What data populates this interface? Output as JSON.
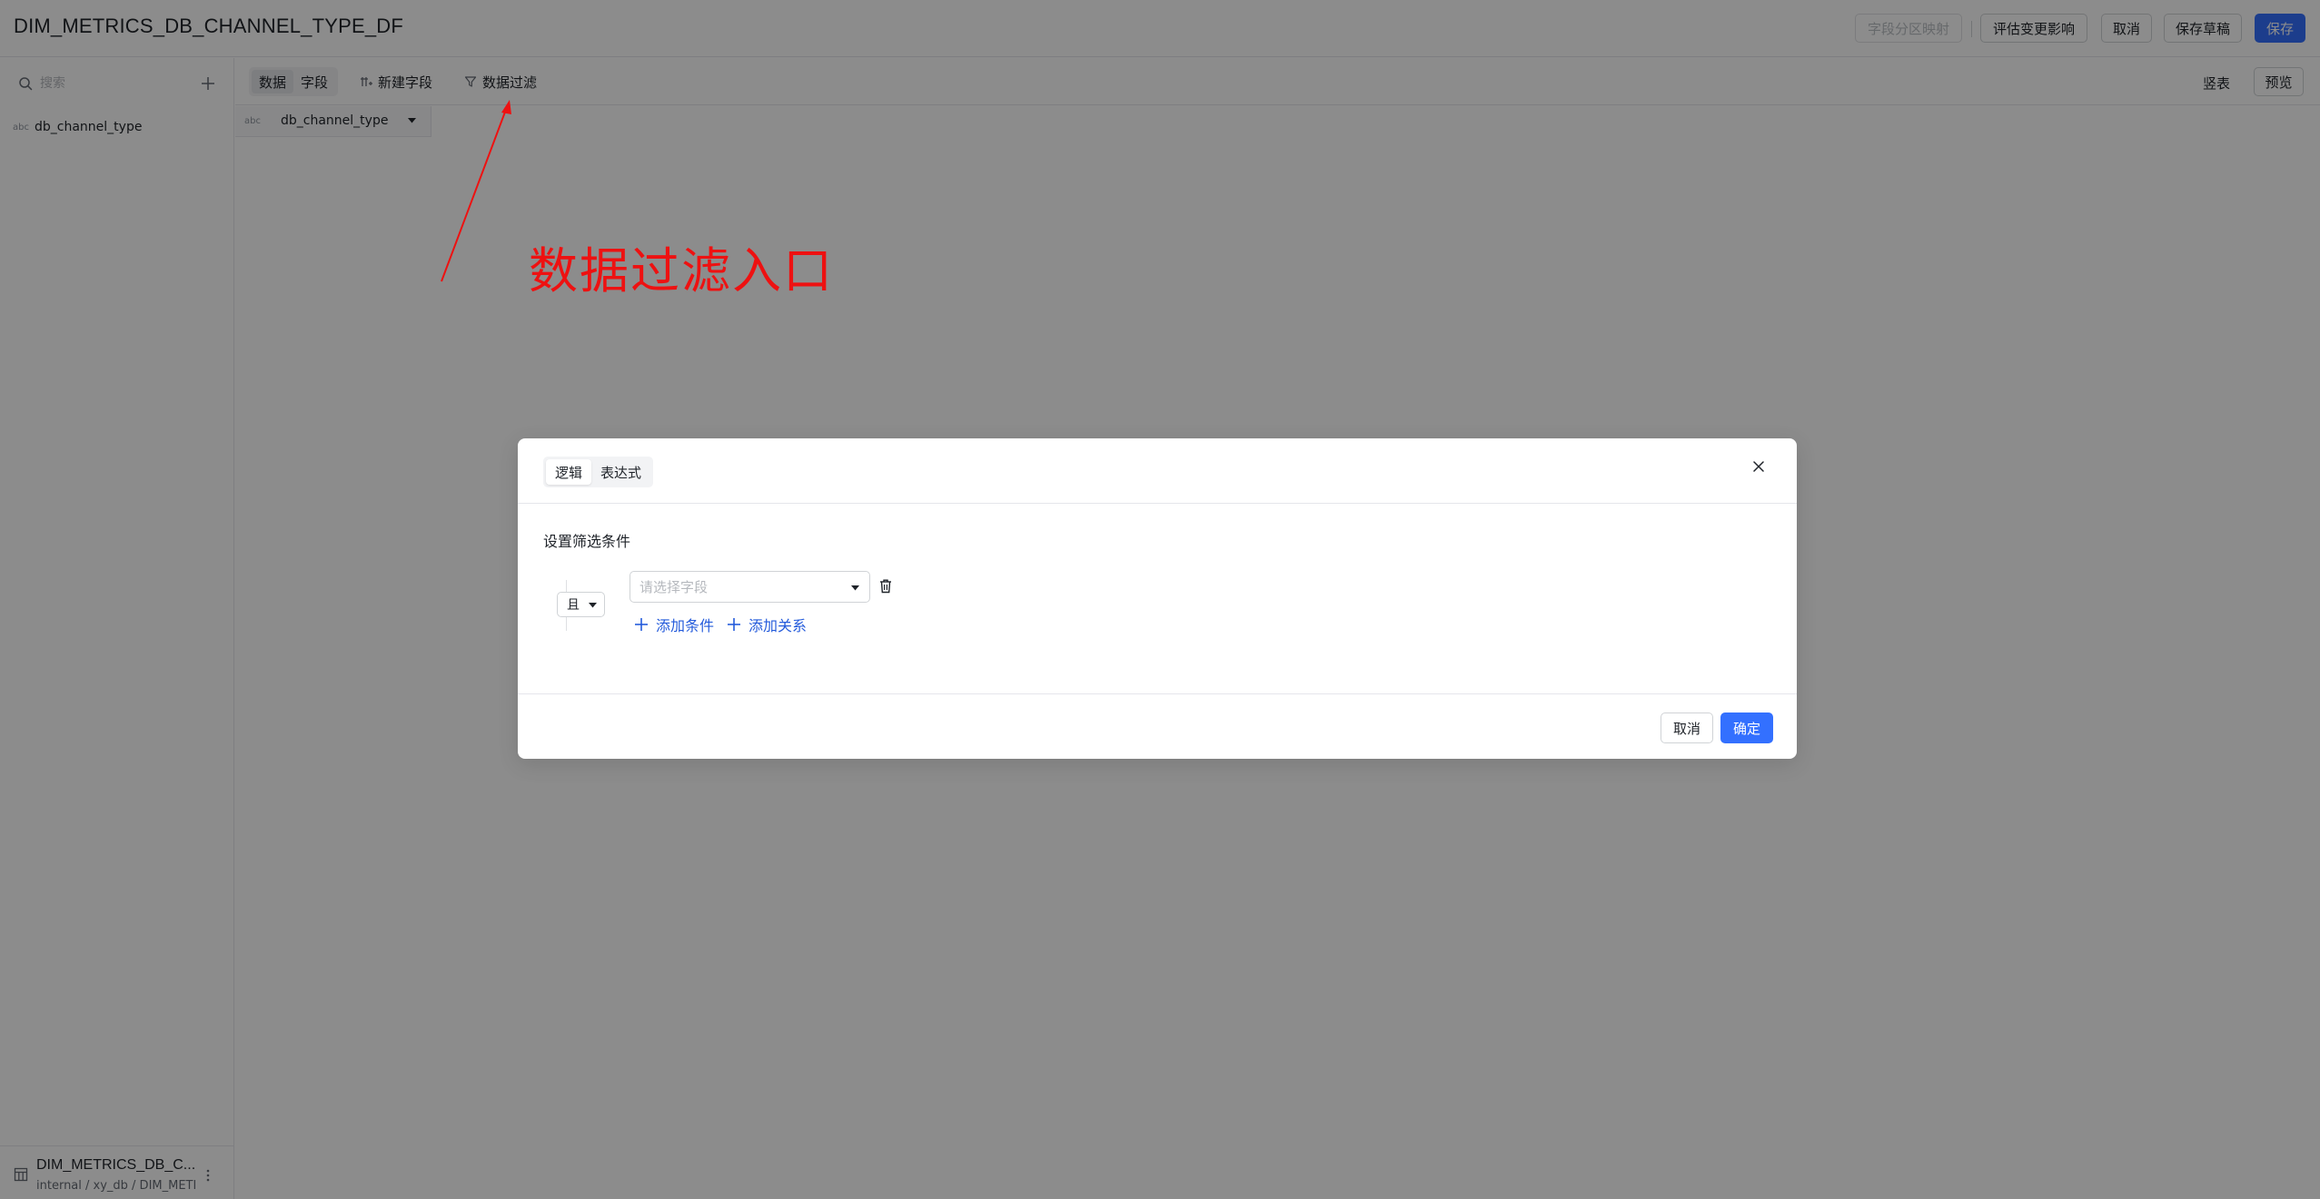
{
  "header": {
    "title": "DIM_METRICS_DB_CHANNEL_TYPE_DF",
    "buttons": {
      "partition_mapping": "字段分区映射",
      "evaluate_impact": "评估变更影响",
      "cancel": "取消",
      "save_draft": "保存草稿",
      "save": "保存"
    }
  },
  "sidebar": {
    "search_placeholder": "搜索",
    "fields": [
      {
        "type_icon": "abc",
        "label": "db_channel_type"
      }
    ],
    "dataset": {
      "name": "DIM_METRICS_DB_C...",
      "path": "internal / xy_db / DIM_METR"
    }
  },
  "toolbar": {
    "tabs": [
      "数据",
      "字段"
    ],
    "active_tab": "数据",
    "new_field": "新建字段",
    "data_filter": "数据过滤",
    "vertical_table": "竖表",
    "preview": "预览"
  },
  "table": {
    "columns": [
      {
        "type_icon": "abc",
        "name": "db_channel_type"
      }
    ]
  },
  "annotation": {
    "text": "数据过滤入口",
    "color": "#ee1111"
  },
  "modal": {
    "tabs": [
      "逻辑",
      "表达式"
    ],
    "active_tab": "逻辑",
    "section_label": "设置筛选条件",
    "logic_operator": "且",
    "field_placeholder": "请选择字段",
    "add_condition": "添加条件",
    "add_relation": "添加关系",
    "cancel": "取消",
    "confirm": "确定"
  },
  "colors": {
    "primary": "#3370ff",
    "link": "#245bdb",
    "annotation": "#ee1111"
  }
}
